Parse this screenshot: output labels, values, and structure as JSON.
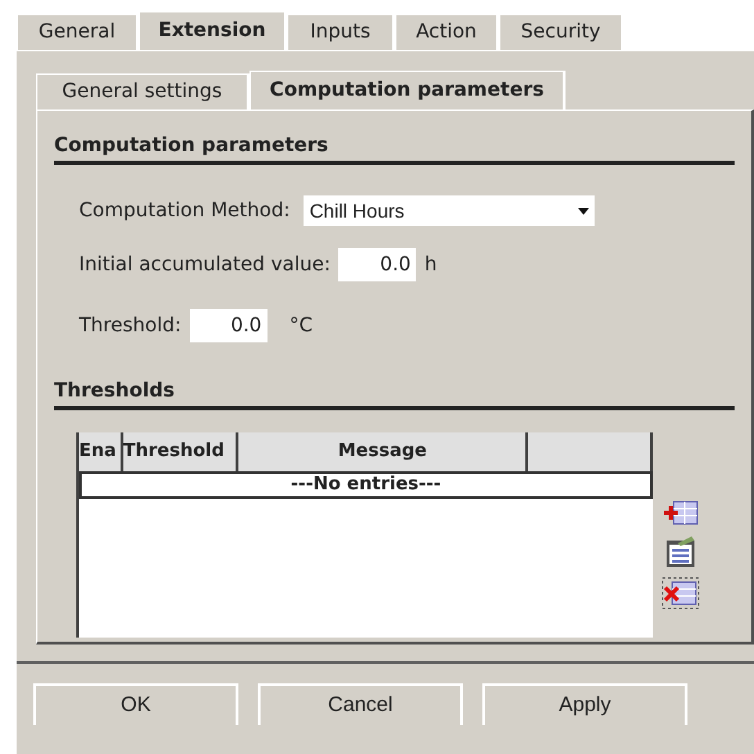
{
  "tabs": [
    {
      "label": "General",
      "selected": false
    },
    {
      "label": "Extension",
      "selected": true
    },
    {
      "label": "Inputs",
      "selected": false
    },
    {
      "label": "Action",
      "selected": false
    },
    {
      "label": "Security",
      "selected": false
    }
  ],
  "subtabs": [
    {
      "label": "General settings",
      "selected": false
    },
    {
      "label": "Computation parameters",
      "selected": true
    }
  ],
  "section_title": "Computation parameters",
  "method": {
    "label": "Computation Method:",
    "value": "Chill Hours"
  },
  "initial": {
    "label": "Initial accumulated value:",
    "value": "0.0",
    "unit": "h"
  },
  "threshold": {
    "label": "Threshold:",
    "value": "0.0",
    "unit": "°C"
  },
  "thresholds": {
    "title": "Thresholds",
    "columns": [
      "Ena",
      "Threshold",
      "Message"
    ],
    "empty_text": "---No entries---"
  },
  "buttons": [
    "OK",
    "Cancel",
    "Apply"
  ]
}
